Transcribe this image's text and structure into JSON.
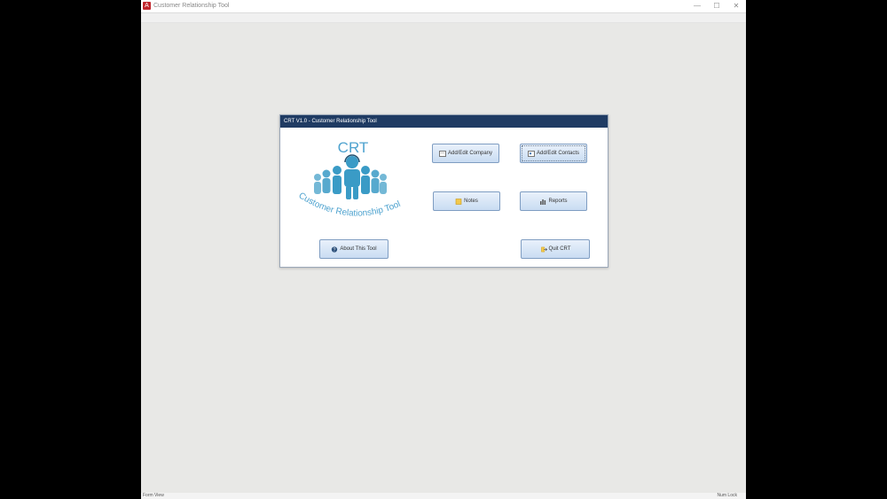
{
  "window": {
    "title": "Customer Relationship Tool"
  },
  "window_controls": {
    "minimize": "—",
    "maximize": "☐",
    "close": "✕"
  },
  "statusbar": {
    "left": "Form View",
    "right": "Num Lock"
  },
  "dialog": {
    "title": "CRT V1.0 - Customer Relationship Tool"
  },
  "logo": {
    "heading": "CRT",
    "tagline": "Customer Relationship Tool"
  },
  "buttons": {
    "add_edit_company": "Add/Edit Company",
    "add_edit_contacts": "Add/Edit Contacts",
    "notes": "Notes",
    "reports": "Reports",
    "about": "About This Tool",
    "quit": "Quit CRT"
  },
  "colors": {
    "dialog_title_bg": "#1f3b63",
    "logo_blue": "#3a9bc6",
    "button_border": "#7f9dc2"
  }
}
